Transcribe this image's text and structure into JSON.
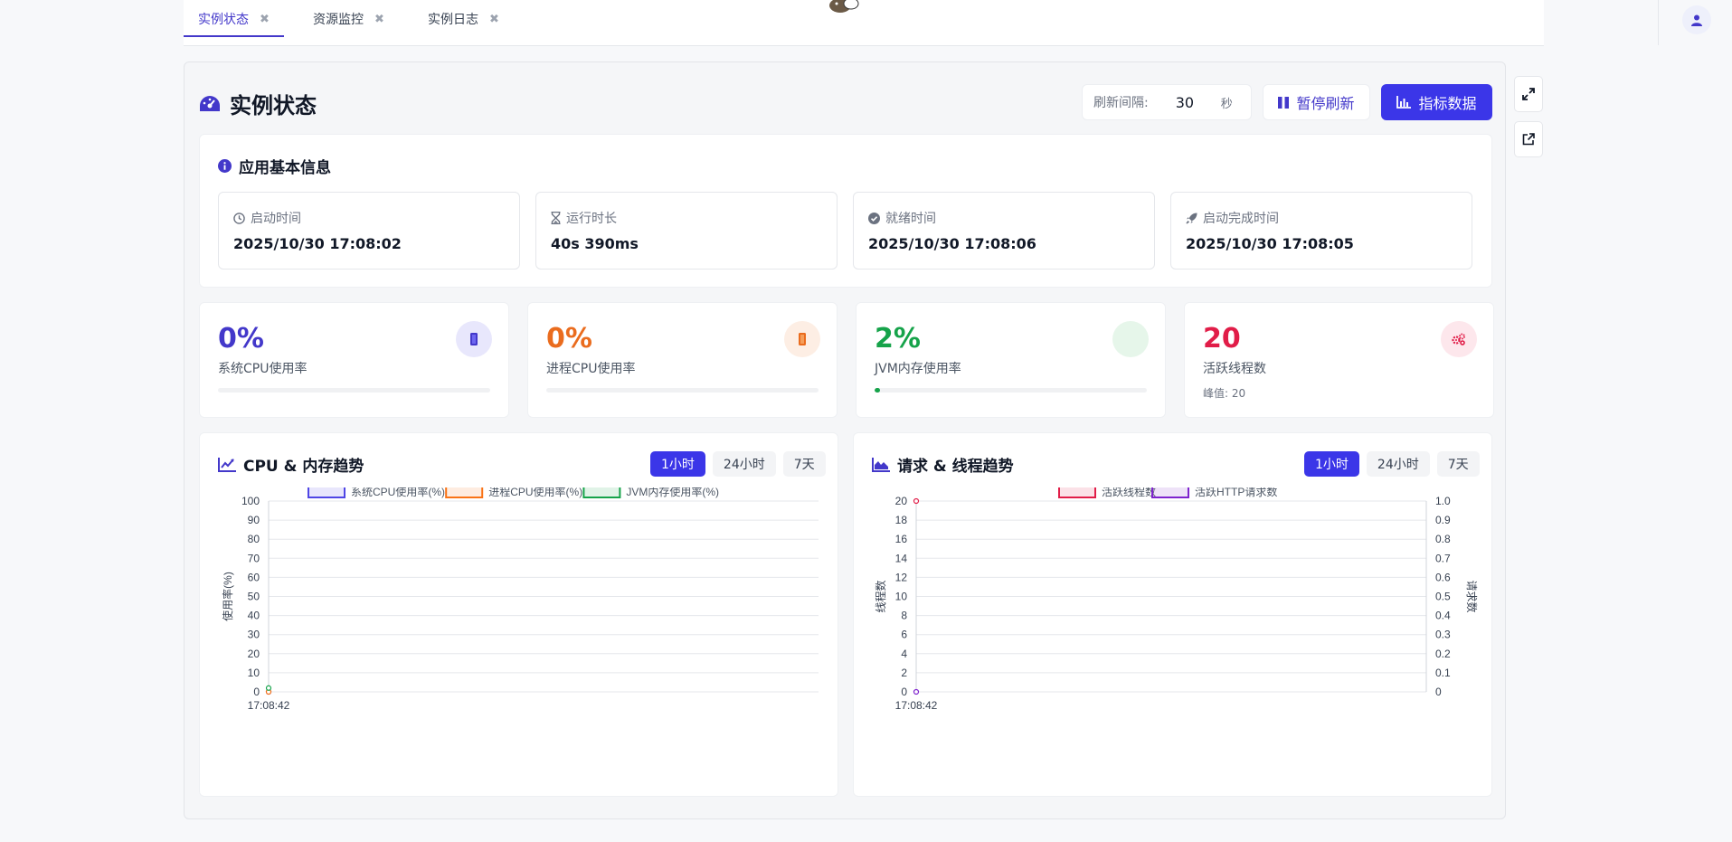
{
  "tabs": [
    {
      "label": "实例状态",
      "active": true
    },
    {
      "label": "资源监控",
      "active": false
    },
    {
      "label": "实例日志",
      "active": false
    }
  ],
  "page": {
    "title": "实例状态"
  },
  "refresh": {
    "label": "刷新间隔:",
    "value": "30",
    "unit": "秒",
    "pause_label": "暂停刷新",
    "metrics_label": "指标数据"
  },
  "app_info": {
    "title": "应用基本信息",
    "items": [
      {
        "label": "启动时间",
        "value": "2025/10/30 17:08:02",
        "icon": "clock-icon"
      },
      {
        "label": "运行时长",
        "value": "40s 390ms",
        "icon": "hourglass-icon"
      },
      {
        "label": "就绪时间",
        "value": "2025/10/30 17:08:06",
        "icon": "check-circle-icon"
      },
      {
        "label": "启动完成时间",
        "value": "2025/10/30 17:08:05",
        "icon": "rocket-icon"
      }
    ]
  },
  "stats": [
    {
      "value": "0%",
      "label": "系统CPU使用率",
      "progress": 0,
      "color": "#4338ca",
      "icon": "cpu-icon"
    },
    {
      "value": "0%",
      "label": "进程CPU使用率",
      "progress": 0,
      "color": "#ea6c1e",
      "icon": "process-icon"
    },
    {
      "value": "2%",
      "label": "JVM内存使用率",
      "progress": 2,
      "color": "#16a34a",
      "icon": "memory-icon"
    },
    {
      "value": "20",
      "label": "活跃线程数",
      "sub": "峰值: 20",
      "color": "#e11d48",
      "icon": "gears-icon"
    }
  ],
  "charts": {
    "ranges": [
      "1小时",
      "24小时",
      "7天"
    ],
    "cpu": {
      "title": "CPU & 内存趋势"
    },
    "req": {
      "title": "请求 & 线程趋势"
    }
  },
  "chart_data": [
    {
      "type": "line",
      "title": "",
      "x": [
        "17:08:42"
      ],
      "ylabel": "使用率(%)",
      "ylim": [
        0,
        100
      ],
      "yticks": [
        0,
        10,
        20,
        30,
        40,
        50,
        60,
        70,
        80,
        90,
        100
      ],
      "series": [
        {
          "name": "系统CPU使用率(%)",
          "color": "#4f46e5",
          "values": [
            0
          ]
        },
        {
          "name": "进程CPU使用率(%)",
          "color": "#f97316",
          "values": [
            0
          ]
        },
        {
          "name": "JVM内存使用率(%)",
          "color": "#16a34a",
          "values": [
            2
          ]
        }
      ],
      "legend": "top",
      "grid": true
    },
    {
      "type": "line",
      "title": "",
      "x": [
        "17:08:42"
      ],
      "ylabel": "线程数",
      "y2label": "请求数",
      "ylim": [
        0,
        20
      ],
      "y2lim": [
        0,
        1
      ],
      "yticks": [
        0,
        2,
        4,
        6,
        8,
        10,
        12,
        14,
        16,
        18,
        20
      ],
      "y2ticks": [
        "0",
        "0.1",
        "0.2",
        "0.3",
        "0.4",
        "0.5",
        "0.6",
        "0.7",
        "0.8",
        "0.9",
        "1.0"
      ],
      "series": [
        {
          "name": "活跃线程数",
          "color": "#e11d48",
          "axis": "left",
          "values": [
            20
          ]
        },
        {
          "name": "活跃HTTP请求数",
          "color": "#7e22ce",
          "axis": "right",
          "values": [
            0
          ]
        }
      ],
      "legend": "top",
      "grid": true
    }
  ]
}
